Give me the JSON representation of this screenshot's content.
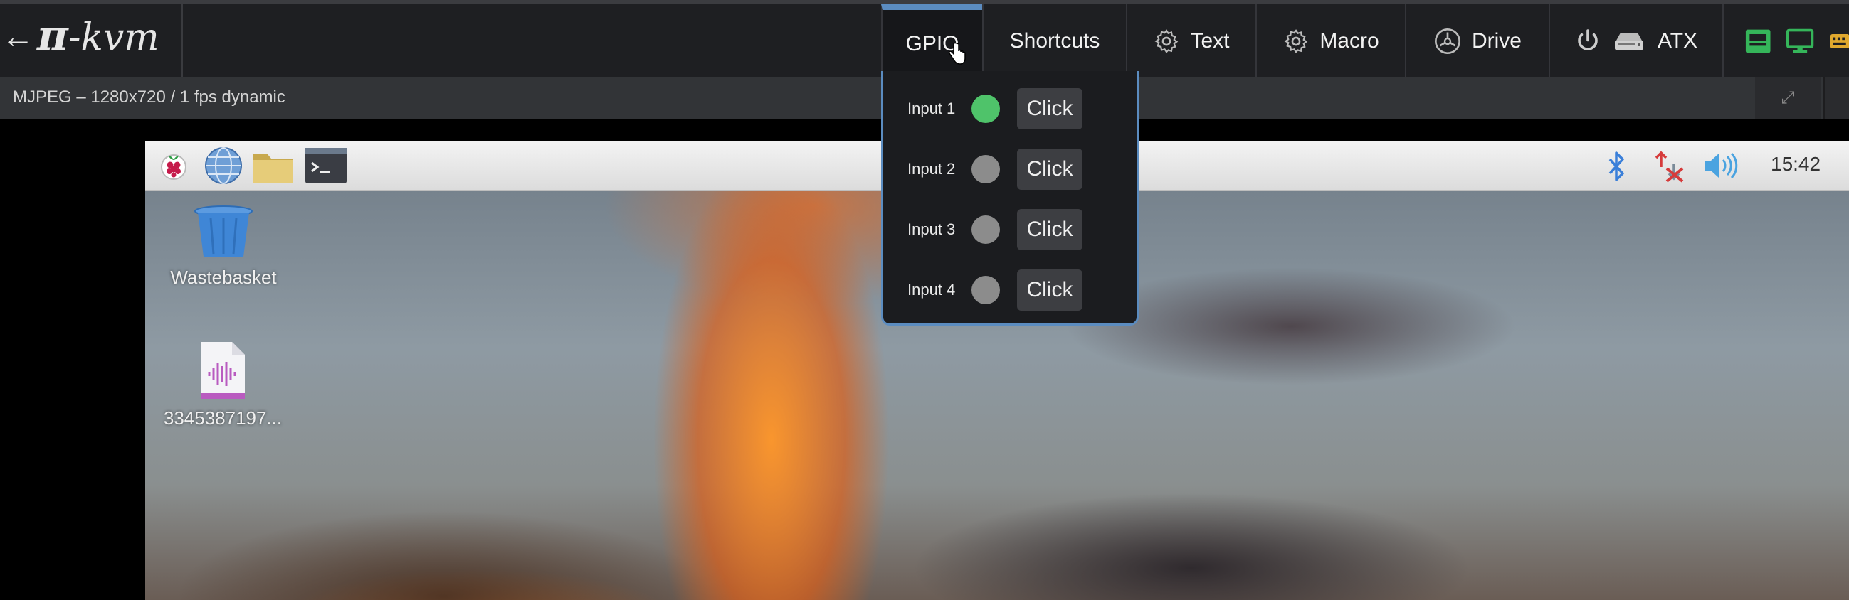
{
  "brand": {
    "back_arrow": "←",
    "logo_pi": "π",
    "logo_text": "-kvm"
  },
  "menu": [
    {
      "label": "GPIO",
      "icon": null,
      "active": true
    },
    {
      "label": "Shortcuts",
      "icon": null
    },
    {
      "label": "Text",
      "icon": "gear-icon"
    },
    {
      "label": "Macro",
      "icon": "gear-icon"
    },
    {
      "label": "Drive",
      "icon": "disc-icon"
    },
    {
      "label": "ATX",
      "icon": "power-icon"
    }
  ],
  "stream": {
    "info": "MJPEG – 1280x720 / 1 fps dynamic",
    "fullscreen_icon": "expand-icon"
  },
  "remote": {
    "clock": "15:42",
    "desktop_icons": [
      {
        "label": "Wastebasket",
        "icon": "trash-icon"
      },
      {
        "label": "3345387197...",
        "icon": "audio-file-icon"
      }
    ]
  },
  "gpio": {
    "click_label": "Click",
    "inputs": [
      {
        "label": "Input 1",
        "state": "on"
      },
      {
        "label": "Input 2",
        "state": "off"
      },
      {
        "label": "Input 3",
        "state": "off"
      },
      {
        "label": "Input 4",
        "state": "off"
      }
    ]
  },
  "colors": {
    "led_on": "#4fc36a",
    "led_off": "#8c8c8c",
    "accent": "#5b8cc0",
    "indicator_green": "#35b55a"
  }
}
